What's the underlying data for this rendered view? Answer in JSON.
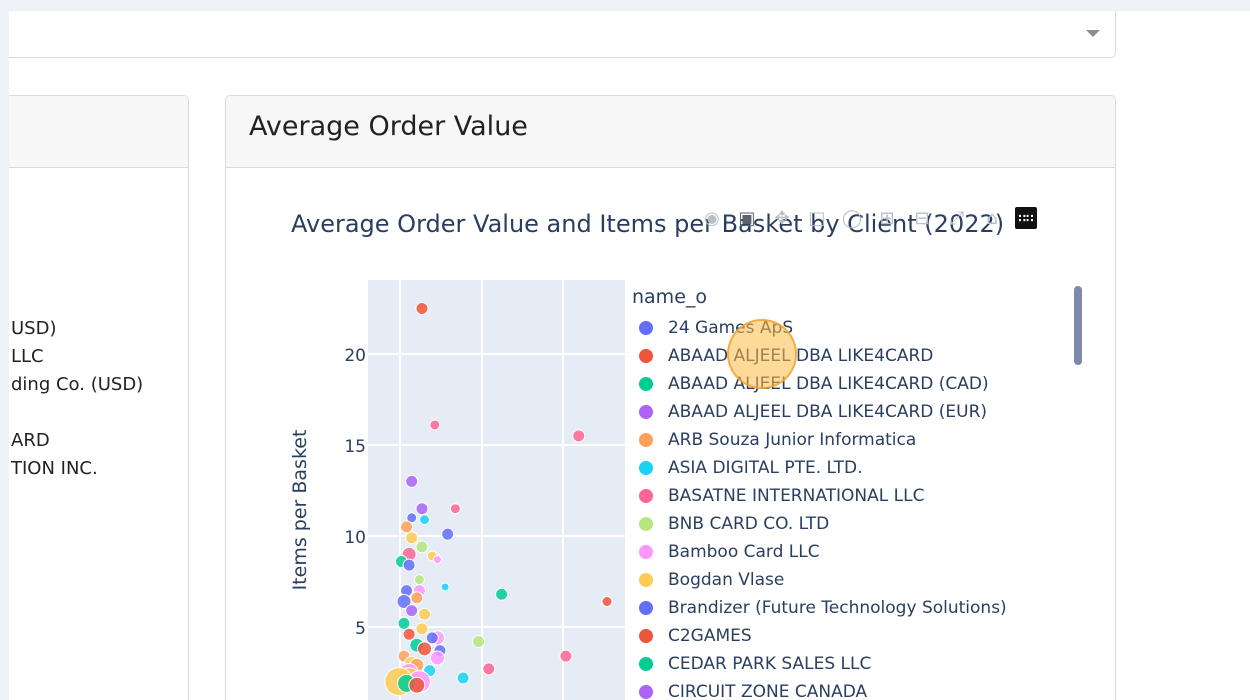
{
  "dropdown": {
    "caret_icon": "chevron-down-icon"
  },
  "left_card": {
    "items": [
      "USD)",
      "LLC",
      "ding Co. (USD)",
      "",
      "ARD",
      "TION INC."
    ]
  },
  "right_card": {
    "title": "Average Order Value"
  },
  "modebar": {
    "icons": [
      "camera-icon",
      "download-icon",
      "pan-icon",
      "box-select-icon",
      "lasso-icon",
      "zoom-in-icon",
      "zoom-out-icon",
      "autoscale-icon",
      "reset-axes-icon",
      "plotly-logo-icon"
    ]
  },
  "chart_data": {
    "type": "scatter",
    "title": "Average Order Value and Items per Basket by Client (2022)",
    "ylabel": "Items per Basket",
    "xlabel": "",
    "y_ticks": [
      "5",
      "10",
      "15",
      "20"
    ],
    "legend_title": "name_o",
    "legend": [
      {
        "name": "24 Games ApS",
        "color": "#636efa"
      },
      {
        "name": "ABAAD ALJEEL DBA LIKE4CARD",
        "color": "#ef553b"
      },
      {
        "name": "ABAAD ALJEEL DBA LIKE4CARD (CAD)",
        "color": "#00cc96"
      },
      {
        "name": "ABAAD ALJEEL DBA LIKE4CARD (EUR)",
        "color": "#ab63fa"
      },
      {
        "name": "ARB Souza Junior Informatica",
        "color": "#ffa15a"
      },
      {
        "name": "ASIA DIGITAL PTE. LTD.",
        "color": "#19d3f3"
      },
      {
        "name": "BASATNE INTERNATIONAL LLC",
        "color": "#ff6692"
      },
      {
        "name": "BNB CARD CO. LTD",
        "color": "#b6e880"
      },
      {
        "name": "Bamboo Card LLC",
        "color": "#ff97ff"
      },
      {
        "name": "Bogdan Vlase",
        "color": "#fecb52"
      },
      {
        "name": "Brandizer (Future Technology Solutions)",
        "color": "#636efa"
      },
      {
        "name": "C2GAMES",
        "color": "#ef553b"
      },
      {
        "name": "CEDAR PARK SALES LLC",
        "color": "#00cc96"
      },
      {
        "name": "CIRCUIT ZONE CANADA",
        "color": "#ab63fa"
      }
    ],
    "ylim": [
      0,
      24
    ],
    "points": [
      {
        "x": 0.21,
        "y": 22.5,
        "s": 6,
        "c": "#ef553b"
      },
      {
        "x": 0.26,
        "y": 16.1,
        "s": 5,
        "c": "#ff6692"
      },
      {
        "x": 0.82,
        "y": 15.5,
        "s": 6,
        "c": "#ff6692"
      },
      {
        "x": 0.17,
        "y": 13.0,
        "s": 6,
        "c": "#ab63fa"
      },
      {
        "x": 0.34,
        "y": 11.5,
        "s": 5,
        "c": "#ff6692"
      },
      {
        "x": 0.21,
        "y": 11.5,
        "s": 6,
        "c": "#ab63fa"
      },
      {
        "x": 0.17,
        "y": 11.0,
        "s": 5,
        "c": "#636efa"
      },
      {
        "x": 0.22,
        "y": 10.9,
        "s": 5,
        "c": "#19d3f3"
      },
      {
        "x": 0.15,
        "y": 10.5,
        "s": 6,
        "c": "#ffa15a"
      },
      {
        "x": 0.31,
        "y": 10.1,
        "s": 6,
        "c": "#636efa"
      },
      {
        "x": 0.17,
        "y": 9.9,
        "s": 6,
        "c": "#fecb52"
      },
      {
        "x": 0.21,
        "y": 9.4,
        "s": 6,
        "c": "#b6e880"
      },
      {
        "x": 0.16,
        "y": 9.0,
        "s": 7,
        "c": "#ff6692"
      },
      {
        "x": 0.13,
        "y": 8.6,
        "s": 6,
        "c": "#00cc96"
      },
      {
        "x": 0.25,
        "y": 8.9,
        "s": 5,
        "c": "#fecb52"
      },
      {
        "x": 0.27,
        "y": 8.7,
        "s": 4,
        "c": "#ff97ff"
      },
      {
        "x": 0.16,
        "y": 8.4,
        "s": 6,
        "c": "#636efa"
      },
      {
        "x": 0.2,
        "y": 7.6,
        "s": 5,
        "c": "#b6e880"
      },
      {
        "x": 0.3,
        "y": 7.2,
        "s": 4,
        "c": "#19d3f3"
      },
      {
        "x": 0.2,
        "y": 7.0,
        "s": 6,
        "c": "#ff97ff"
      },
      {
        "x": 0.15,
        "y": 7.0,
        "s": 6,
        "c": "#636efa"
      },
      {
        "x": 0.52,
        "y": 6.8,
        "s": 6,
        "c": "#00cc96"
      },
      {
        "x": 0.93,
        "y": 6.4,
        "s": 5,
        "c": "#ef553b"
      },
      {
        "x": 0.14,
        "y": 6.4,
        "s": 7,
        "c": "#636efa"
      },
      {
        "x": 0.19,
        "y": 6.6,
        "s": 6,
        "c": "#ffa15a"
      },
      {
        "x": 0.22,
        "y": 5.7,
        "s": 6,
        "c": "#fecb52"
      },
      {
        "x": 0.17,
        "y": 5.9,
        "s": 6,
        "c": "#ab63fa"
      },
      {
        "x": 0.14,
        "y": 5.2,
        "s": 6,
        "c": "#00cc96"
      },
      {
        "x": 0.21,
        "y": 4.9,
        "s": 6,
        "c": "#fecb52"
      },
      {
        "x": 0.16,
        "y": 4.6,
        "s": 6,
        "c": "#ef553b"
      },
      {
        "x": 0.27,
        "y": 4.4,
        "s": 7,
        "c": "#ff97ff"
      },
      {
        "x": 0.25,
        "y": 4.4,
        "s": 6,
        "c": "#636efa"
      },
      {
        "x": 0.43,
        "y": 4.2,
        "s": 6,
        "c": "#b6e880"
      },
      {
        "x": 0.19,
        "y": 4.0,
        "s": 7,
        "c": "#00cc96"
      },
      {
        "x": 0.22,
        "y": 3.8,
        "s": 7,
        "c": "#ef553b"
      },
      {
        "x": 0.28,
        "y": 3.7,
        "s": 6,
        "c": "#636efa"
      },
      {
        "x": 0.77,
        "y": 3.4,
        "s": 6,
        "c": "#ff6692"
      },
      {
        "x": 0.14,
        "y": 3.4,
        "s": 6,
        "c": "#ffa15a"
      },
      {
        "x": 0.27,
        "y": 3.3,
        "s": 7,
        "c": "#ff97ff"
      },
      {
        "x": 0.17,
        "y": 3.0,
        "s": 7,
        "c": "#fecb52"
      },
      {
        "x": 0.19,
        "y": 2.9,
        "s": 7,
        "c": "#ffa15a"
      },
      {
        "x": 0.47,
        "y": 2.7,
        "s": 6,
        "c": "#ff6692"
      },
      {
        "x": 0.24,
        "y": 2.6,
        "s": 6,
        "c": "#19d3f3"
      },
      {
        "x": 0.16,
        "y": 2.5,
        "s": 9,
        "c": "#ff97ff"
      },
      {
        "x": 0.37,
        "y": 2.2,
        "s": 6,
        "c": "#19d3f3"
      },
      {
        "x": 0.16,
        "y": 2.1,
        "s": 12,
        "c": "#fecb52"
      },
      {
        "x": 0.2,
        "y": 2.0,
        "s": 11,
        "c": "#ff97ff"
      },
      {
        "x": 0.12,
        "y": 2.0,
        "s": 14,
        "c": "#fecb52"
      },
      {
        "x": 0.15,
        "y": 1.9,
        "s": 9,
        "c": "#00cc96"
      },
      {
        "x": 0.19,
        "y": 1.8,
        "s": 8,
        "c": "#ef553b"
      }
    ]
  }
}
